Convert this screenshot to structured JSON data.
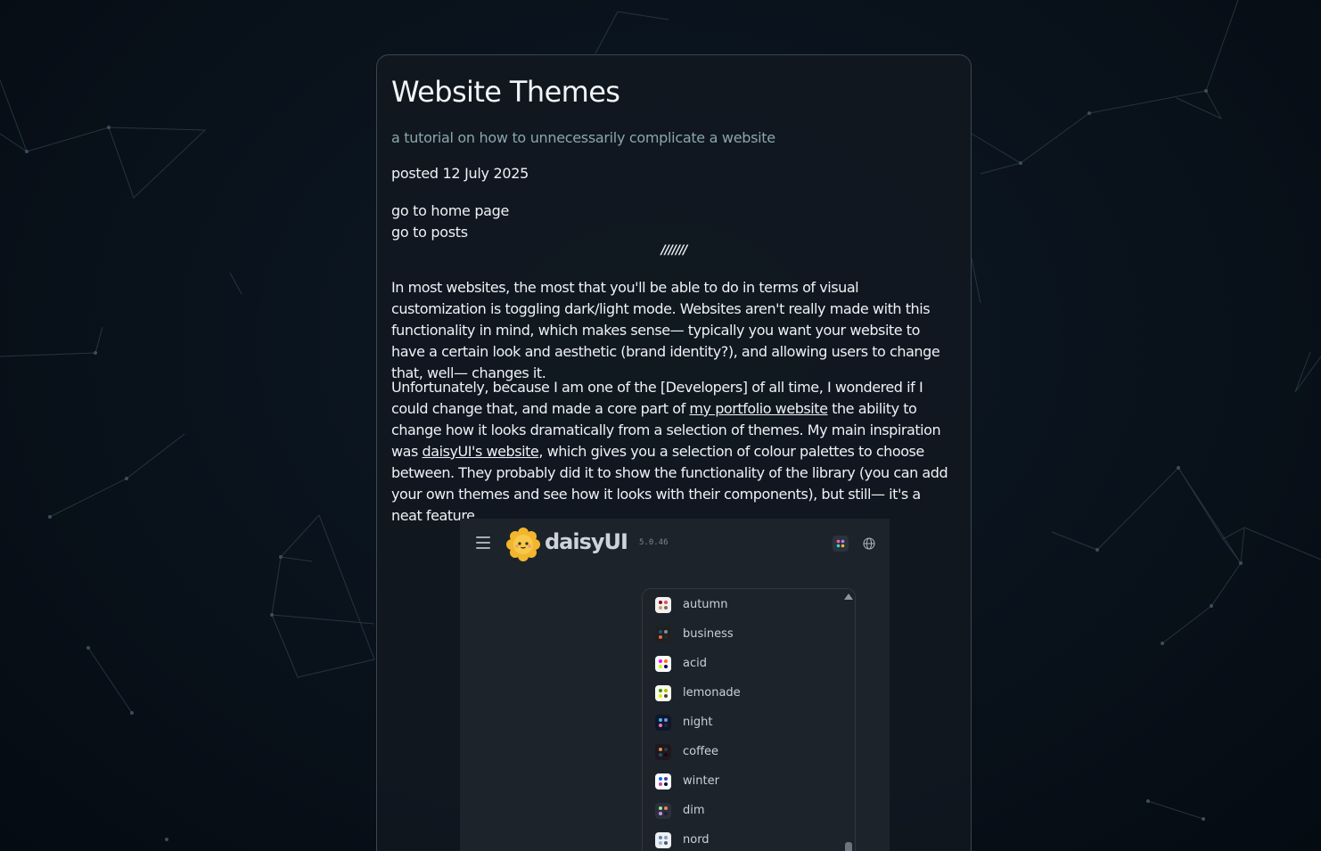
{
  "post": {
    "title": "Website Themes",
    "subtitle": "a tutorial on how to unnecessarily complicate a website",
    "posted": "posted 12 July 2025",
    "nav": {
      "home": "go to home page",
      "posts": "go to posts"
    },
    "divider": "///////",
    "paragraph1": "In most websites, the most that you'll be able to do in terms of visual customization is toggling dark/light mode. Websites aren't really made with this functionality in mind, which makes sense— typically you want your website to have a certain look and aesthetic (brand identity?), and allowing users to change that, well— changes it.",
    "paragraph2": {
      "part1": "Unfortunately, because I am one of the [Developers] of all time, I wondered if I could change that, and made a core part of ",
      "link1": "my portfolio website",
      "part2": " the ability to change how it looks dramatically from a selection of themes. My main inspiration was ",
      "link2": "daisyUI's website",
      "part3": ", which gives you a selection of colour palettes to choose between. They probably did it to show the functionality of the library (you can add your own themes and see how it looks with their components), but still— it's a neat feature."
    }
  },
  "screenshot": {
    "brand": "daisyUI",
    "version": "5.0.46",
    "icons": {
      "menu": "hamburger-menu-icon",
      "logo": "daisyui-logo-icon",
      "theme": "palette-icon",
      "language": "globe-icon"
    },
    "themes": [
      {
        "label": "autumn",
        "bg": "#f1f1f1",
        "dots": [
          "#8c0327",
          "#d85251",
          "#d59b6a",
          "#826a5c"
        ]
      },
      {
        "label": "business",
        "bg": "#202020",
        "dots": [
          "#1c4e80",
          "#7c909a",
          "#ea6947",
          "#23282e"
        ]
      },
      {
        "label": "acid",
        "bg": "#fafafa",
        "dots": [
          "#ff00ff",
          "#ff7400",
          "#cbfd03",
          "#140151"
        ]
      },
      {
        "label": "lemonade",
        "bg": "#f8fdef",
        "dots": [
          "#419400",
          "#bbbc00",
          "#ebe800",
          "#414141"
        ]
      },
      {
        "label": "night",
        "bg": "#0f172a",
        "dots": [
          "#38bdf8",
          "#818cf8",
          "#f471b5",
          "#1e293b"
        ]
      },
      {
        "label": "coffee",
        "bg": "#20161f",
        "dots": [
          "#db924b",
          "#263e3f",
          "#10576d",
          "#120c12"
        ]
      },
      {
        "label": "winter",
        "bg": "#ffffff",
        "dots": [
          "#0069ff",
          "#463aa2",
          "#c148ac",
          "#021431"
        ]
      },
      {
        "label": "dim",
        "bg": "#2a303c",
        "dots": [
          "#9fe88d",
          "#ff7d5c",
          "#c792e9",
          "#1c212b"
        ]
      },
      {
        "label": "nord",
        "bg": "#eceff4",
        "dots": [
          "#5e81ac",
          "#81a1c1",
          "#88c0d0",
          "#4c566a"
        ]
      }
    ]
  }
}
